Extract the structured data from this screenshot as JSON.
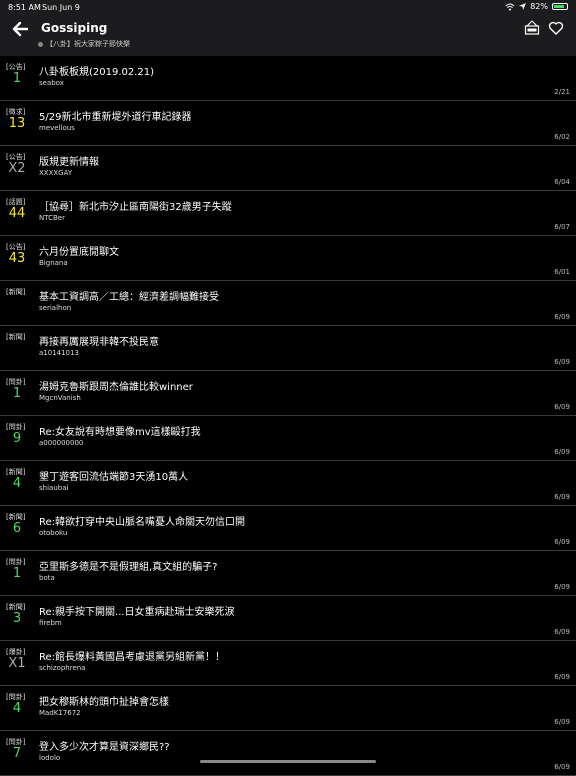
{
  "status": {
    "time": "8:51 AM",
    "date": "Sun Jun 9",
    "battery": "82%",
    "battery_level": 0.82
  },
  "header": {
    "title": "Gossiping",
    "subtitle": "【八卦】祝大家粽子節快樂"
  },
  "colors": {
    "green": "#4cd964",
    "yellow": "#f8e71c",
    "gray": "#aaaaaa"
  },
  "posts": [
    {
      "category": "[公告]",
      "count": "1",
      "count_color": "green",
      "title": "八卦板板規(2019.02.21)",
      "author": "seabox",
      "date": "2/21"
    },
    {
      "category": "[徵求]",
      "count": "13",
      "count_color": "yellow",
      "title": "5/29新北市重新堤外道行車記錄器",
      "author": "mevellous",
      "date": "6/02"
    },
    {
      "category": "[公告]",
      "count": "X2",
      "count_color": "gray",
      "title": "版規更新情報",
      "author": "XXXXGAY",
      "date": "6/04"
    },
    {
      "category": "[話題]",
      "count": "44",
      "count_color": "yellow",
      "title": "［協尋］新北市汐止區南陽街32歲男子失蹤",
      "author": "NTCBer",
      "date": "6/07"
    },
    {
      "category": "[公告]",
      "count": "43",
      "count_color": "yellow",
      "title": "六月份置底閒聊文",
      "author": "Bignana",
      "date": "6/01"
    },
    {
      "category": "[新聞]",
      "count": "",
      "count_color": "green",
      "title": "基本工資調高／工總：經濟差調幅難接受",
      "author": "serialhon",
      "date": "6/09"
    },
    {
      "category": "[新聞]",
      "count": "",
      "count_color": "green",
      "title": "再接再厲展現非韓不投民意",
      "author": "a10141013",
      "date": "6/09"
    },
    {
      "category": "[問卦]",
      "count": "1",
      "count_color": "green",
      "title": "湯姆克魯斯跟周杰倫誰比較winner",
      "author": "MgcnVanish",
      "date": "6/09"
    },
    {
      "category": "[問卦]",
      "count": "9",
      "count_color": "green",
      "title": "Re:女友說有時想要像mv這樣毆打我",
      "author": "a000000000",
      "date": "6/09"
    },
    {
      "category": "[新聞]",
      "count": "4",
      "count_color": "green",
      "title": "墾丁遊客回流估端節3天湧10萬人",
      "author": "shiaubai",
      "date": "6/09"
    },
    {
      "category": "[新聞]",
      "count": "6",
      "count_color": "green",
      "title": "Re:韓欲打穿中央山脈名嘴憂人命關天勿信口開",
      "author": "otoboku",
      "date": "6/09"
    },
    {
      "category": "[問卦]",
      "count": "1",
      "count_color": "green",
      "title": "亞里斯多德是不是假理組,真文組的騙子?",
      "author": "bota",
      "date": "6/09"
    },
    {
      "category": "[新聞]",
      "count": "3",
      "count_color": "green",
      "title": "Re:親手按下開關...日女重病赴瑞士安樂死淚",
      "author": "firebm",
      "date": "6/09"
    },
    {
      "category": "[爆卦]",
      "count": "X1",
      "count_color": "gray",
      "title": "Re:館長爆料黃國昌考慮退黨另組新黨！！",
      "author": "schizophrena",
      "date": "6/09"
    },
    {
      "category": "[問卦]",
      "count": "4",
      "count_color": "green",
      "title": "把女穆斯林的頭巾扯掉會怎樣",
      "author": "MadK17672",
      "date": "6/09"
    },
    {
      "category": "[問卦]",
      "count": "7",
      "count_color": "green",
      "title": "登入多少次才算是資深鄉民??",
      "author": "lodolo",
      "date": "6/09"
    }
  ]
}
